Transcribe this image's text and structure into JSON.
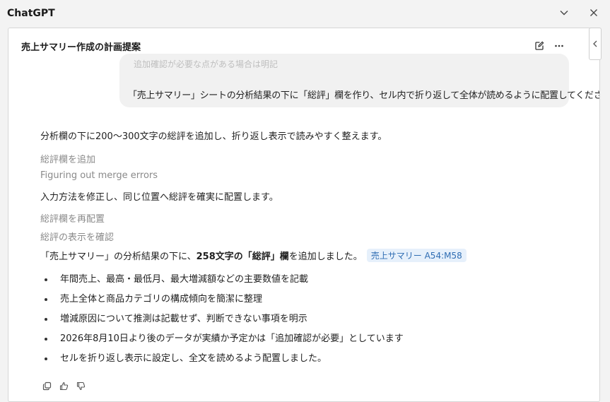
{
  "app": {
    "title": "ChatGPT"
  },
  "conversation": {
    "title": "売上サマリー作成の計画提案"
  },
  "user_message": {
    "faded_text": "追加確認が必要な点がある場合は明記",
    "text": "「売上サマリー」シートの分析結果の下に「総評」欄を作り、セル内で折り返して全体が読めるように配置してください。"
  },
  "assistant": {
    "intro": "分析欄の下に200〜300文字の総評を追加し、折り返し表示で読みやすく整えます。",
    "step1": "総評欄を追加",
    "step2": "Figuring out merge errors",
    "fix_text": "入力方法を修正し、同じ位置へ総評を確実に配置します。",
    "step3": "総評欄を再配置",
    "step4": "総評の表示を確認",
    "result_prefix": "「売上サマリー」の分析結果の下に、",
    "result_bold": "258文字の「総評」欄",
    "result_suffix": "を追加しました。",
    "range_tag": "売上サマリー A54:M58",
    "bullets": [
      "年間売上、最高・最低月、最大増減額などの主要数値を記載",
      "売上全体と商品カテゴリの構成傾向を簡潔に整理",
      "増減原因について推測は記載せず、判断できない事項を明示",
      "2026年8月10日より後のデータが実績か予定かは「追加確認が必要」としています",
      "セルを折り返し表示に設定し、全文を読めるよう配置しました。"
    ]
  },
  "icons": {
    "collapse": "chevron-down-icon",
    "close": "close-icon",
    "edit": "edit-icon",
    "more": "more-icon",
    "sidebar": "chevron-left-icon",
    "copy": "copy-icon",
    "like": "thumbs-up-icon",
    "dislike": "thumbs-down-icon"
  },
  "colors": {
    "tag_bg": "#e6f0fb",
    "tag_text": "#2f6db3",
    "bubble_bg": "#f1f1f1"
  }
}
